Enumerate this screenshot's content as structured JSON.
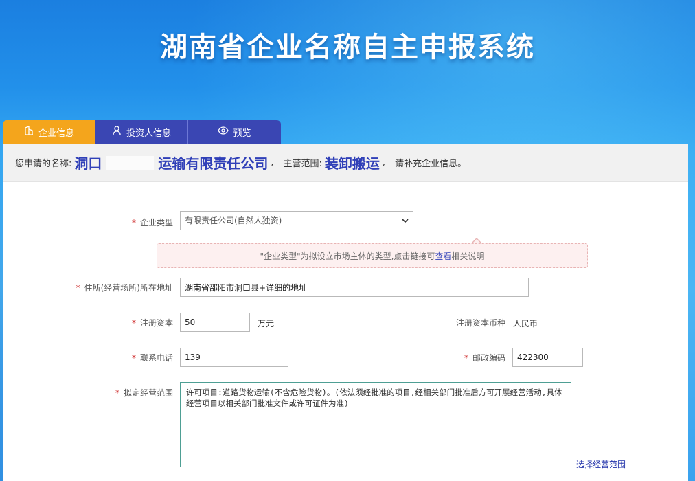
{
  "header": {
    "title": "湖南省企业名称自主申报系统"
  },
  "tabs": [
    {
      "label": "企业信息",
      "icon": "building-icon",
      "active": true
    },
    {
      "label": "投资人信息",
      "icon": "person-icon",
      "active": false
    },
    {
      "label": "预览",
      "icon": "eye-icon",
      "active": false
    }
  ],
  "summary": {
    "prefix": "您申请的名称:",
    "name_part1": "洞口",
    "name_part2": "运输有限责任公司",
    "sep1": ",",
    "scope_label": "主营范围:",
    "scope_value": "装卸搬运",
    "sep2": ",",
    "suffix": "请补充企业信息。"
  },
  "form": {
    "company_type": {
      "required": "*",
      "label": "企业类型",
      "value": "有限责任公司(自然人独资)"
    },
    "hint": {
      "before": "\"企业类型\"为拟设立市场主体的类型,点击链接可",
      "link": "查看",
      "after": "相关说明"
    },
    "address": {
      "required": "*",
      "label": "住所(经营场所)所在地址",
      "value": "湖南省邵阳市洞口县+详细的地址"
    },
    "capital": {
      "required": "*",
      "label": "注册资本",
      "value": "50",
      "unit": "万元"
    },
    "currency": {
      "label": "注册资本币种",
      "value": "人民币"
    },
    "phone": {
      "required": "*",
      "label": "联系电话",
      "value": "139"
    },
    "postcode": {
      "required": "*",
      "label": "邮政编码",
      "value": "422300"
    },
    "scope": {
      "required": "*",
      "label": "拟定经营范围",
      "value": "许可项目:道路货物运输(不含危险货物)。(依法须经批准的项目,经相关部门批准后方可开展经营活动,具体经营项目以相关部门批准文件或许可证件为准)",
      "choose_link": "选择经营范围"
    }
  },
  "colors": {
    "header_bg": "#2290ea",
    "tab_active": "#f4a51c",
    "tab_inactive": "#3a46b3",
    "name_highlight": "#3040b8",
    "required": "#cc2222"
  }
}
